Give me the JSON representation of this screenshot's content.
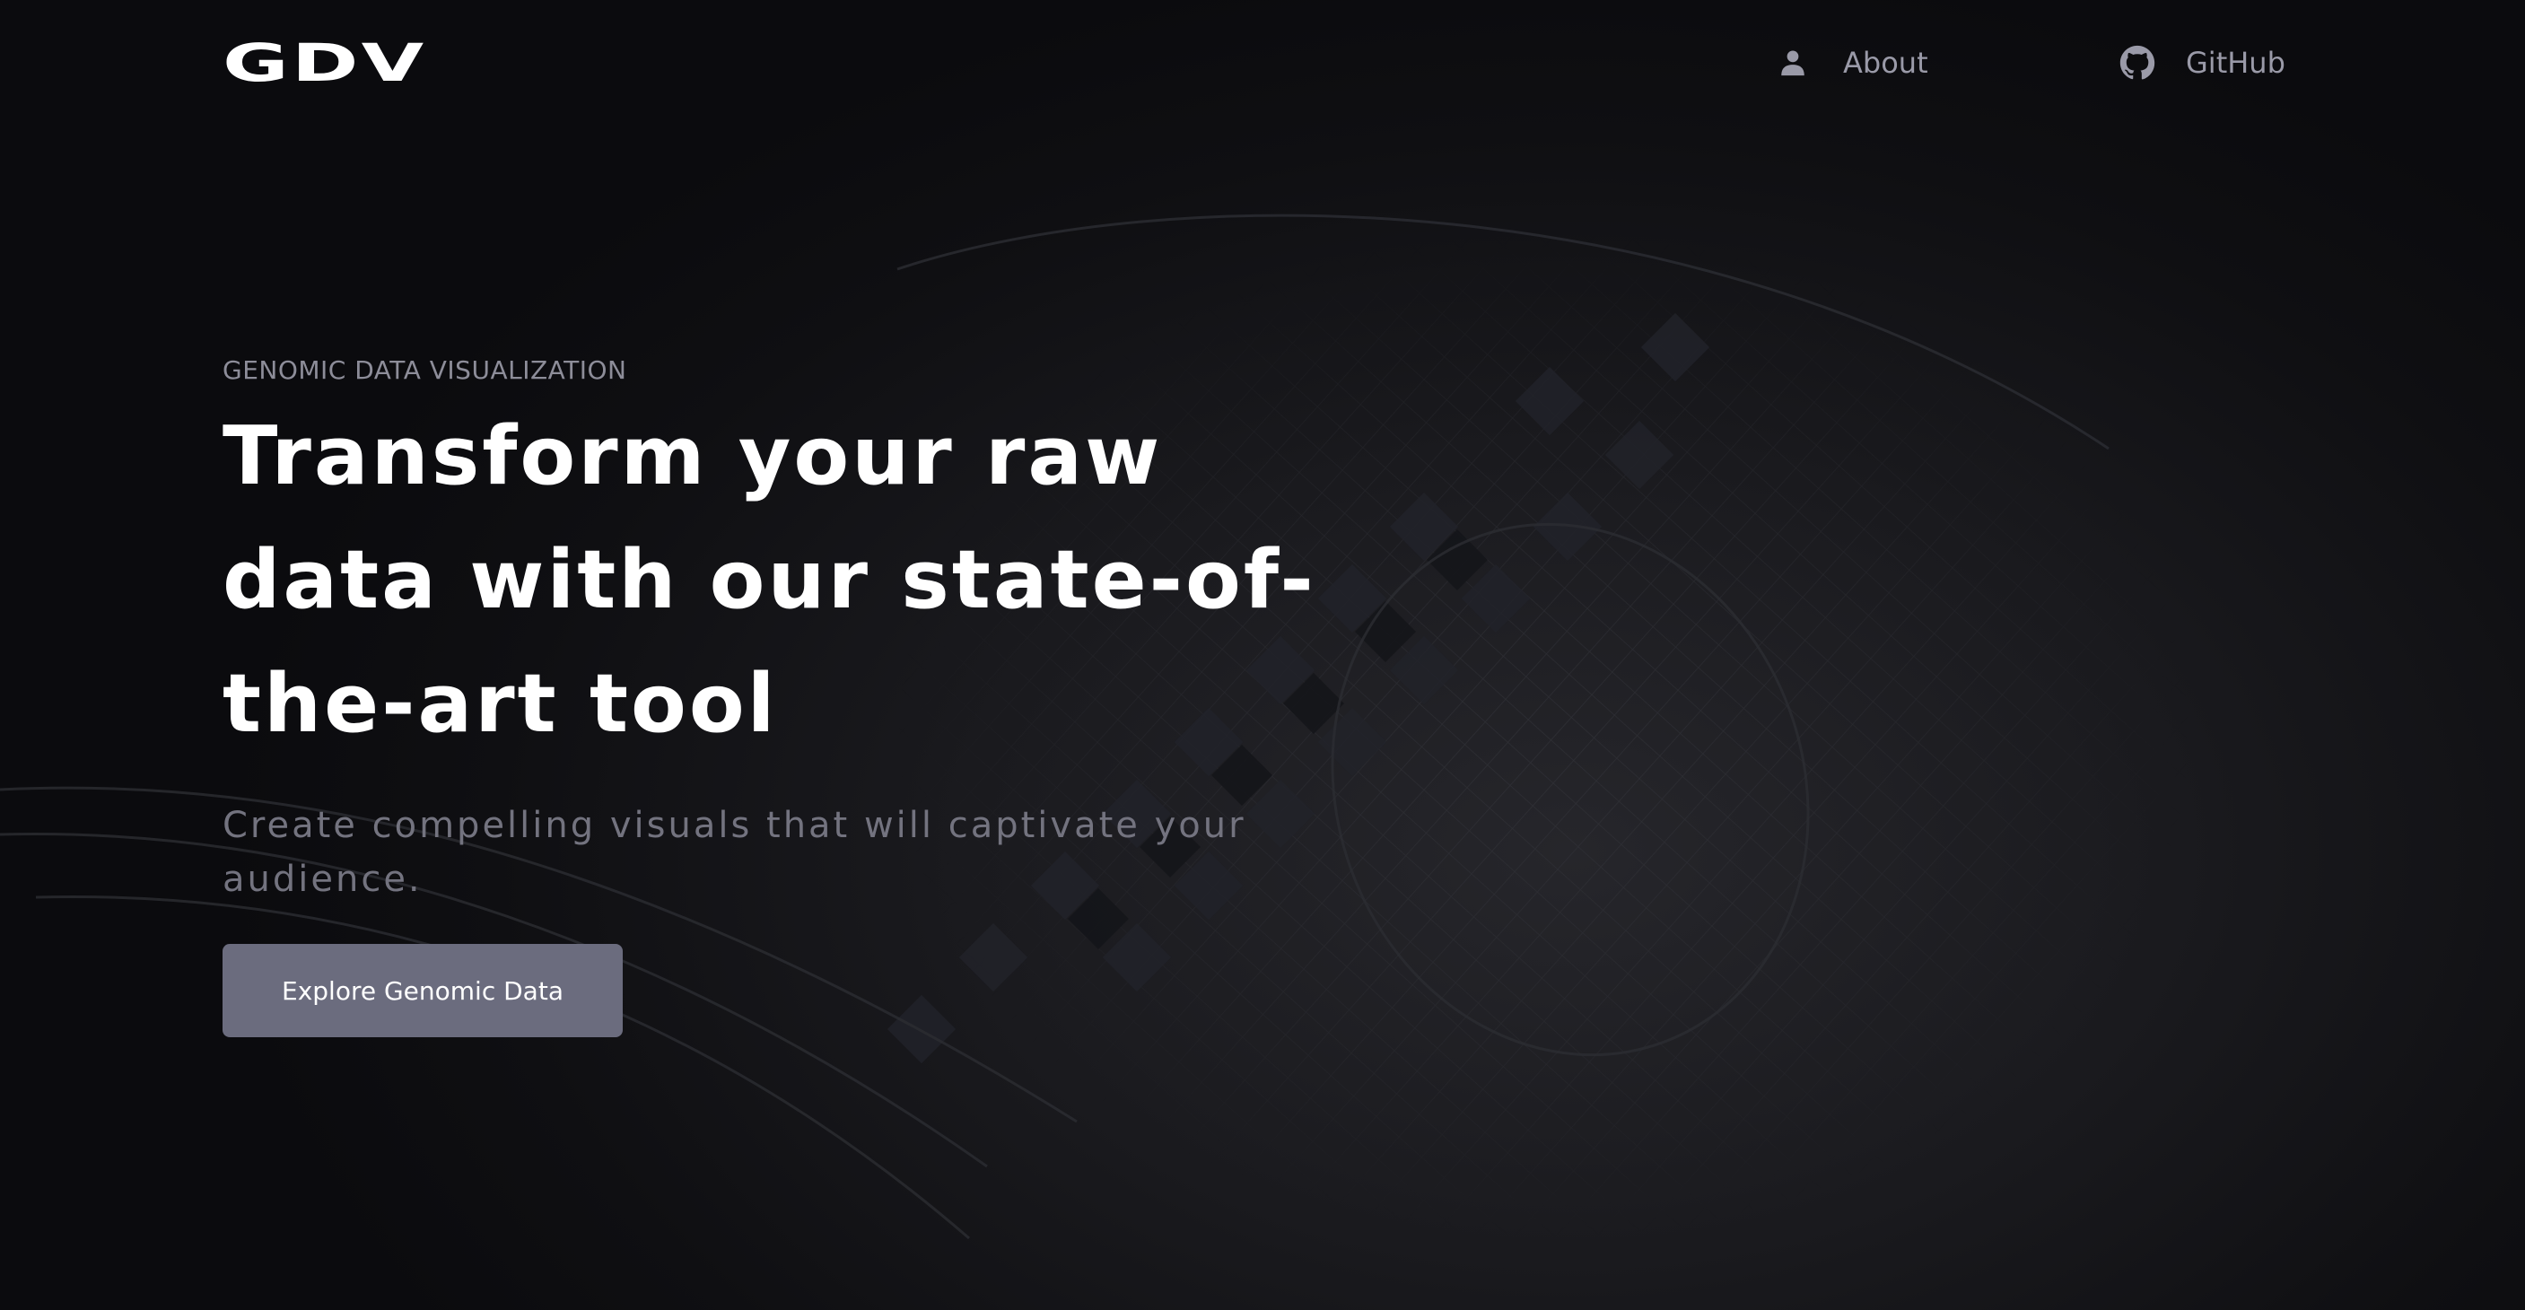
{
  "header": {
    "logo": "GDV",
    "nav": [
      {
        "label": "About",
        "icon": "user-icon"
      },
      {
        "label": "GitHub",
        "icon": "github-icon"
      }
    ]
  },
  "hero": {
    "eyebrow": "GENOMIC DATA VISUALIZATION",
    "headline_lines": [
      "Transform your raw",
      "data with our state-of-",
      "the-art tool"
    ],
    "subtitle": "Create compelling visuals that will captivate your audience.",
    "cta_label": "Explore Genomic Data"
  },
  "colors": {
    "background": "#0d0d10",
    "text_primary": "#ffffff",
    "text_muted": "#9a9aa8",
    "button": "#6b6c7e"
  }
}
